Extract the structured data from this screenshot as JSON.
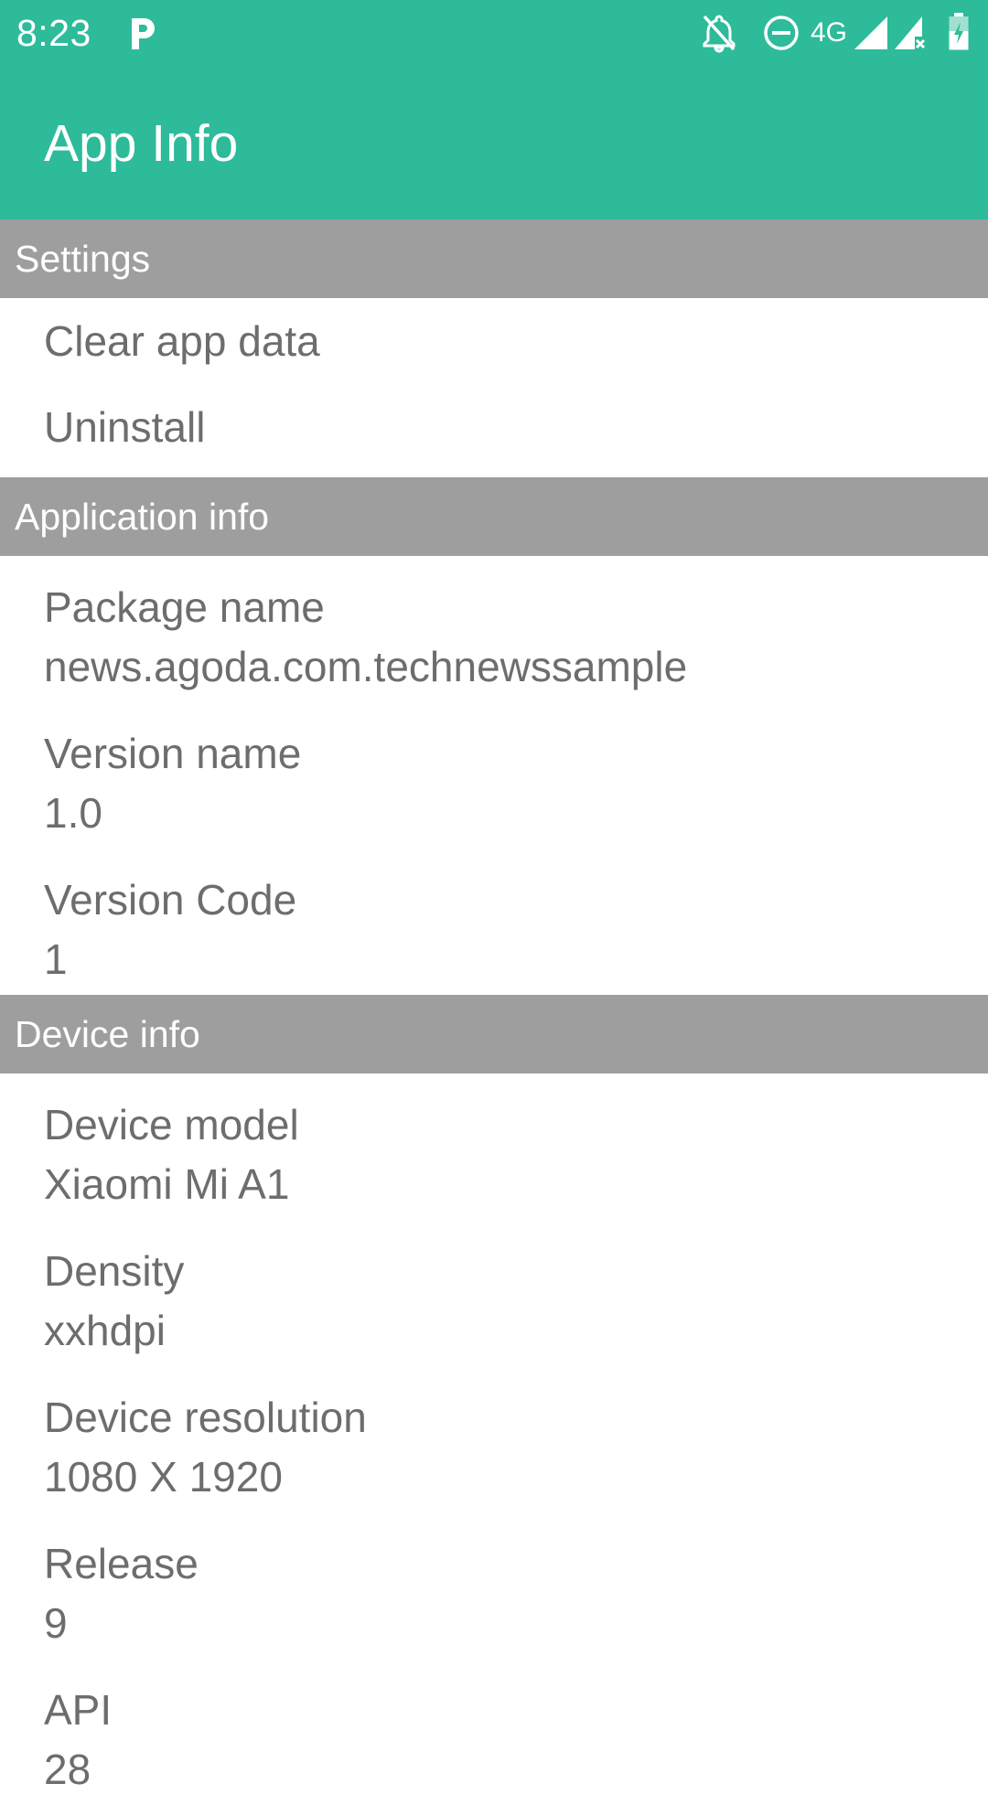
{
  "status_bar": {
    "time": "8:23",
    "network": "4G",
    "icons": [
      "p-app-icon",
      "bell-off-icon",
      "dnd-icon",
      "signal-icon",
      "signal-no-data-icon",
      "battery-charging-icon"
    ],
    "bg_color": "#2dbb9a"
  },
  "app_bar": {
    "title": "App Info",
    "color": "#2dbb9a"
  },
  "sections": {
    "settings": {
      "title": "Settings",
      "items": [
        "Clear app data",
        "Uninstall"
      ]
    },
    "application_info": {
      "title": "Application info",
      "items": [
        {
          "label": "Package name",
          "value": "news.agoda.com.technewssample"
        },
        {
          "label": "Version name",
          "value": "1.0"
        },
        {
          "label": "Version Code",
          "value": "1"
        }
      ]
    },
    "device_info": {
      "title": "Device info",
      "items": [
        {
          "label": "Device model",
          "value": "Xiaomi Mi A1"
        },
        {
          "label": "Density",
          "value": "xxhdpi"
        },
        {
          "label": "Device resolution",
          "value": "1080 X 1920"
        },
        {
          "label": "Release",
          "value": "9"
        },
        {
          "label": "API",
          "value": "28"
        }
      ]
    }
  },
  "colors": {
    "accent": "#2dbb9a",
    "section_header_bg": "#9e9e9e",
    "text": "#6d6d6d"
  }
}
